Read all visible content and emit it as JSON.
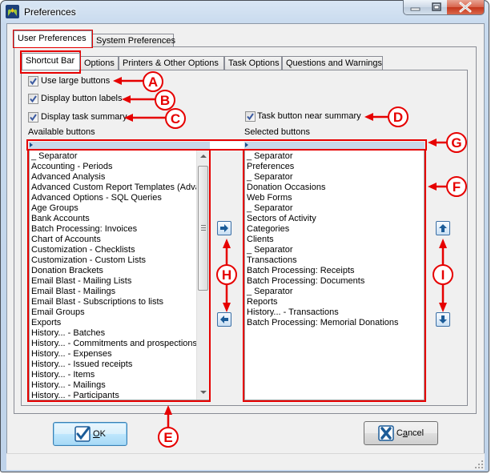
{
  "window": {
    "title": "Preferences",
    "icon": "app-logo-icon",
    "controls": [
      "minimize",
      "maximize",
      "close"
    ]
  },
  "outer_tabs": [
    {
      "label": "User Preferences",
      "active": true
    },
    {
      "label": "System Preferences",
      "active": false
    }
  ],
  "inner_tabs": [
    {
      "label": "Shortcut Bar",
      "active": true
    },
    {
      "label": "Options",
      "active": false
    },
    {
      "label": "Printers & Other Options",
      "active": false
    },
    {
      "label": "Task Options",
      "active": false
    },
    {
      "label": "Questions and Warnings",
      "active": false
    }
  ],
  "options": {
    "use_large_buttons": {
      "label": "Use large buttons",
      "checked": true
    },
    "display_button_labels": {
      "label": "Display button labels",
      "checked": true
    },
    "display_task_summary": {
      "label": "Display task summary",
      "checked": true
    },
    "task_button_near_summary": {
      "label": "Task button near summary",
      "checked": true
    }
  },
  "available": {
    "label": "Available buttons",
    "items": [
      "_ Separator",
      "Accounting - Periods",
      "Advanced Analysis",
      "Advanced Custom Report Templates (Advanced",
      "Advanced Options - SQL Queries",
      "Age Groups",
      "Bank Accounts",
      "Batch Processing: Invoices",
      "Chart of Accounts",
      "Customization - Checklists",
      "Customization - Custom Lists",
      "Donation Brackets",
      "Email Blast - Mailing Lists",
      "Email Blast - Mailings",
      "Email Blast - Subscriptions to lists",
      "Email Groups",
      "Exports",
      "History... - Batches",
      "History... - Commitments and prospections",
      "History... - Expenses",
      "History... - Issued receipts",
      "History... - Items",
      "History... - Mailings",
      "History... - Participants"
    ]
  },
  "selected": {
    "label": "Selected buttons",
    "items": [
      "_ Separator",
      "Preferences",
      "_ Separator",
      "Donation Occasions",
      "Web Forms",
      "_ Separator",
      "Sectors of Activity",
      "Categories",
      "Clients",
      "_ Separator",
      "Transactions",
      "Batch Processing: Receipts",
      "Batch Processing: Documents",
      "_ Separator",
      "Reports",
      "History... - Transactions",
      "Batch Processing: Memorial Donations"
    ]
  },
  "buttons": {
    "ok": {
      "label": "OK",
      "mnemonic_index": 0
    },
    "cancel": {
      "label": "Cancel",
      "mnemonic_index": 1
    }
  },
  "annotations": {
    "A": "A",
    "B": "B",
    "C": "C",
    "D": "D",
    "E": "E",
    "F": "F",
    "G": "G",
    "H": "H",
    "I": "I"
  },
  "colors": {
    "annotation": "#e60000",
    "accent": "#1c5c98",
    "dialog_bg": "#f0f0f0"
  }
}
